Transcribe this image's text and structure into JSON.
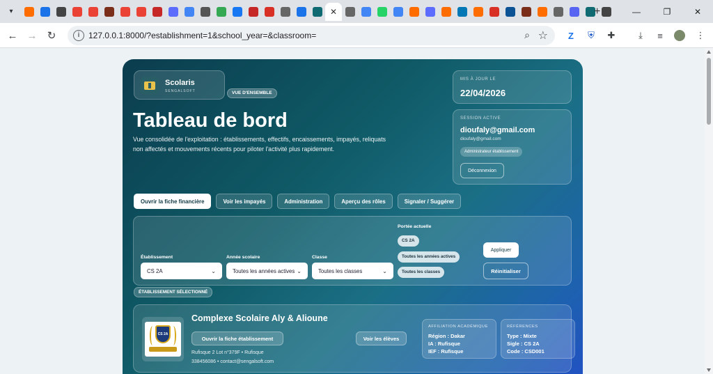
{
  "browser": {
    "tabs": [
      {
        "color": "#ff6d00"
      },
      {
        "color": "#1a73e8"
      },
      {
        "color": "#444444"
      },
      {
        "color": "#ea4335"
      },
      {
        "color": "#ea4335"
      },
      {
        "color": "#7a2e1a"
      },
      {
        "color": "#ea4335"
      },
      {
        "color": "#ea4335"
      },
      {
        "color": "#c62828"
      },
      {
        "color": "#5b6cff"
      },
      {
        "color": "#4285f4"
      },
      {
        "color": "#555555"
      },
      {
        "color": "#34a853"
      },
      {
        "color": "#1877f2"
      },
      {
        "color": "#c62828"
      },
      {
        "color": "#d93025"
      },
      {
        "color": "#666666"
      },
      {
        "color": "#1a73e8"
      },
      {
        "color": "#0f6a72"
      },
      {
        "color": "active"
      },
      {
        "color": "#666666"
      },
      {
        "color": "#4285f4"
      },
      {
        "color": "#25d366"
      },
      {
        "color": "#4285f4"
      },
      {
        "color": "#ff6d00"
      },
      {
        "color": "#5b6cff"
      },
      {
        "color": "#ff6d00"
      },
      {
        "color": "#0077b5"
      },
      {
        "color": "#ff6d00"
      },
      {
        "color": "#d93025"
      },
      {
        "color": "#0b5394"
      },
      {
        "color": "#7a2e1a"
      },
      {
        "color": "#ff6d00"
      },
      {
        "color": "#666666"
      },
      {
        "color": "#5865f2"
      },
      {
        "color": "#0f6a72"
      },
      {
        "color": "#444444"
      }
    ],
    "new_tab": "+",
    "url": "127.0.0.1:8000/?establishment=1&school_year=&classroom="
  },
  "header": {
    "brand_name": "Scolaris",
    "brand_sub": "SENGALSOFT",
    "overview_pill": "VUE D'ENSEMBLE",
    "title": "Tableau de bord",
    "description": "Vue consolidée de l'exploitation : établissements, effectifs, encaissements, impayés, reliquats non affectés et mouvements récents pour piloter l'activité plus rapidement."
  },
  "update_card": {
    "label": "MIS À JOUR LE",
    "date": "22/04/2026"
  },
  "session_card": {
    "label": "SESSION ACTIVE",
    "user": "dioufaly@gmail.com",
    "email": "dioufaly@gmail.com",
    "role": "Administrateur établissement",
    "logout": "Déconnexion"
  },
  "actions": {
    "open_finance": "Ouvrir la fiche financière",
    "unpaid": "Voir les impayés",
    "admin": "Administration",
    "roles": "Aperçu des rôles",
    "report": "Signaler / Suggérer"
  },
  "filters": {
    "establishment_label": "Établissement",
    "establishment_value": "CS 2A",
    "year_label": "Année scolaire",
    "year_value": "Toutes les années actives",
    "class_label": "Classe",
    "class_value": "Toutes les classes",
    "scope_label": "Portée actuelle",
    "scope_chips": [
      "CS 2A",
      "Toutes les années actives",
      "Toutes les classes"
    ],
    "apply": "Appliquer",
    "reset": "Réinitialiser"
  },
  "selected_label": "ÉTABLISSEMENT SÉLECTIONNÉ",
  "school": {
    "name": "Complexe Scolaire Aly & Alioune",
    "logo_text": "CS 2A",
    "open_button": "Ouvrir la fiche établissement",
    "students_button": "Voir les élèves",
    "address": "Rufisque 2 Lot n°379F • Rufisque",
    "contact": "338456086 • contact@sengalsoft.com",
    "affiliation": {
      "title": "AFFILIATION ACADÉMIQUE",
      "region": "Région : Dakar",
      "ia": "IA : Rufisque",
      "ief": "IEF : Rufisque"
    },
    "references": {
      "title": "RÉFÉRENCES",
      "type": "Type : Mixte",
      "sigle": "Sigle : CS 2A",
      "code": "Code : CSD001"
    }
  }
}
